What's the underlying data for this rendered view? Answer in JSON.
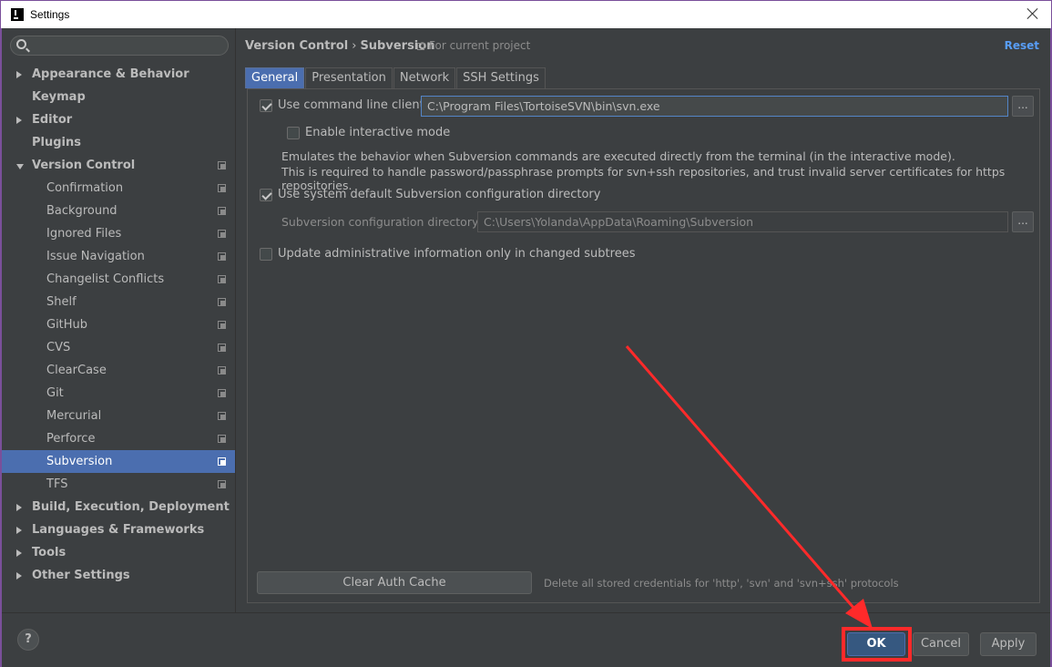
{
  "window": {
    "title": "Settings"
  },
  "search": {
    "placeholder": ""
  },
  "sidebar": {
    "items": [
      {
        "label": "Appearance & Behavior"
      },
      {
        "label": "Keymap"
      },
      {
        "label": "Editor"
      },
      {
        "label": "Plugins"
      },
      {
        "label": "Version Control"
      },
      {
        "label": "Confirmation"
      },
      {
        "label": "Background"
      },
      {
        "label": "Ignored Files"
      },
      {
        "label": "Issue Navigation"
      },
      {
        "label": "Changelist Conflicts"
      },
      {
        "label": "Shelf"
      },
      {
        "label": "GitHub"
      },
      {
        "label": "CVS"
      },
      {
        "label": "ClearCase"
      },
      {
        "label": "Git"
      },
      {
        "label": "Mercurial"
      },
      {
        "label": "Perforce"
      },
      {
        "label": "Subversion"
      },
      {
        "label": "TFS"
      },
      {
        "label": "Build, Execution, Deployment"
      },
      {
        "label": "Languages & Frameworks"
      },
      {
        "label": "Tools"
      },
      {
        "label": "Other Settings"
      }
    ]
  },
  "header": {
    "crumb_parent": "Version Control",
    "crumb_sep": "›",
    "crumb_current": "Subversion",
    "scope": "For current project",
    "reset": "Reset"
  },
  "tabs": [
    {
      "label": "General"
    },
    {
      "label": "Presentation"
    },
    {
      "label": "Network"
    },
    {
      "label": "SSH Settings"
    }
  ],
  "general": {
    "use_cli_label": "Use command line client:",
    "use_cli_checked": true,
    "cli_path": "C:\\Program Files\\TortoiseSVN\\bin\\svn.exe",
    "interactive_label": "Enable interactive mode",
    "interactive_checked": false,
    "desc_line1": "Emulates the behavior when Subversion commands are executed directly from the terminal (in the interactive mode).",
    "desc_line2": "This is required to handle password/passphrase prompts for svn+ssh repositories, and trust invalid server certificates for https repositories.",
    "use_default_dir_label": "Use system default Subversion configuration directory",
    "use_default_dir_checked": true,
    "config_dir_label": "Subversion configuration directory:",
    "config_dir_value": "C:\\Users\\Yolanda\\AppData\\Roaming\\Subversion",
    "update_admin_label": "Update administrative information only in changed subtrees",
    "update_admin_checked": false,
    "browse": "...",
    "clear_cache": "Clear Auth Cache",
    "clear_note": "Delete all stored credentials for 'http', 'svn' and 'svn+ssh' protocols"
  },
  "footer": {
    "help": "?",
    "ok": "OK",
    "cancel": "Cancel",
    "apply": "Apply"
  },
  "colors": {
    "accent": "#4b6eaf",
    "annotation": "#ff2a2a",
    "link": "#589df6"
  }
}
